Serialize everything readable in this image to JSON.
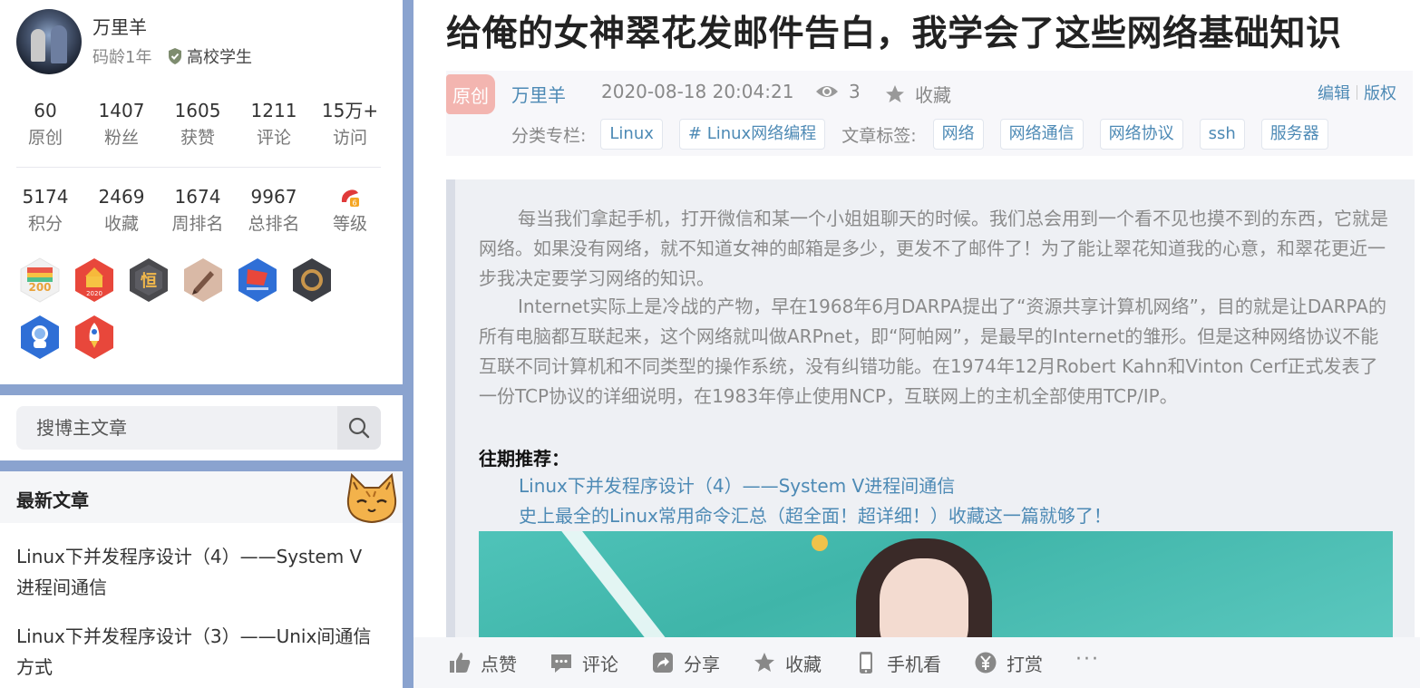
{
  "profile": {
    "name": "万里羊",
    "code_age": "码龄1年",
    "school": "高校学生",
    "stats1": [
      {
        "num": "60",
        "label": "原创"
      },
      {
        "num": "1407",
        "label": "粉丝"
      },
      {
        "num": "1605",
        "label": "获赞"
      },
      {
        "num": "1211",
        "label": "评论"
      },
      {
        "num": "15万+",
        "label": "访问"
      }
    ],
    "stats2": [
      {
        "num": "5174",
        "label": "积分"
      },
      {
        "num": "2469",
        "label": "收藏"
      },
      {
        "num": "1674",
        "label": "周排名"
      },
      {
        "num": "9967",
        "label": "总排名"
      },
      {
        "label": "等级"
      }
    ],
    "badges": [
      {
        "icon": "badge-200-icon",
        "text": "200"
      },
      {
        "icon": "badge-2020-icon",
        "text": "2020"
      },
      {
        "icon": "badge-persistence-icon",
        "text": "恒"
      },
      {
        "icon": "badge-pencil-icon"
      },
      {
        "icon": "badge-flag-icon"
      },
      {
        "icon": "badge-bronze-icon"
      },
      {
        "icon": "badge-astronaut-icon"
      },
      {
        "icon": "badge-rocket-icon"
      }
    ]
  },
  "search": {
    "placeholder": "搜博主文章"
  },
  "latest": {
    "title": "最新文章",
    "items": [
      "Linux下并发程序设计（4）——System V进程间通信",
      "Linux下并发程序设计（3）——Unix间通信方式"
    ]
  },
  "article": {
    "title": "给俺的女神翠花发邮件告白，我学会了这些网络基础知识",
    "orig_tag": "原创",
    "author": "万里羊",
    "date": "2020-08-18 20:04:21",
    "views": "3",
    "fav_label": "收藏",
    "edit_label": "编辑",
    "copyright_label": "版权",
    "category_label": "分类专栏:",
    "categories": [
      "Linux",
      "# Linux网络编程"
    ],
    "tags_label": "文章标签:",
    "tags": [
      "网络",
      "网络通信",
      "网络协议",
      "ssh",
      "服务器"
    ],
    "para1": "每当我们拿起手机，打开微信和某一个小姐姐聊天的时候。我们总会用到一个看不见也摸不到的东西，它就是网络。如果没有网络，就不知道女神的邮箱是多少，更发不了邮件了！为了能让翠花知道我的心意，和翠花更近一步我决定要学习网络的知识。",
    "para2": "Internet实际上是冷战的产物，早在1968年6月DARPA提出了“资源共享计算机网络”，目的就是让DARPA的所有电脑都互联起来，这个网络就叫做ARPnet，即“阿帕网”，是最早的Internet的雏形。但是这种网络协议不能互联不同计算机和不同类型的操作系统，没有纠错功能。在1974年12月Robert Kahn和Vinton Cerf正式发表了一份TCP协议的详细说明，在1983年停止使用NCP，互联网上的主机全部使用TCP/IP。",
    "rec_title": "往期推荐：",
    "rec_links": [
      "Linux下并发程序设计（4）——System V进程间通信",
      "史上最全的Linux常用命令汇总（超全面！超详细！）收藏这一篇就够了！"
    ]
  },
  "actions": [
    {
      "icon": "thumbs-up-icon",
      "label": "点赞"
    },
    {
      "icon": "comment-icon",
      "label": "评论"
    },
    {
      "icon": "share-icon",
      "label": "分享"
    },
    {
      "icon": "star-icon",
      "label": "收藏"
    },
    {
      "icon": "phone-icon",
      "label": "手机看"
    },
    {
      "icon": "yen-icon",
      "label": "打赏"
    }
  ],
  "colors": {
    "page_background": "#8aa3cf",
    "link": "#4d8ab5",
    "original_tag": "#f3b5b0"
  }
}
